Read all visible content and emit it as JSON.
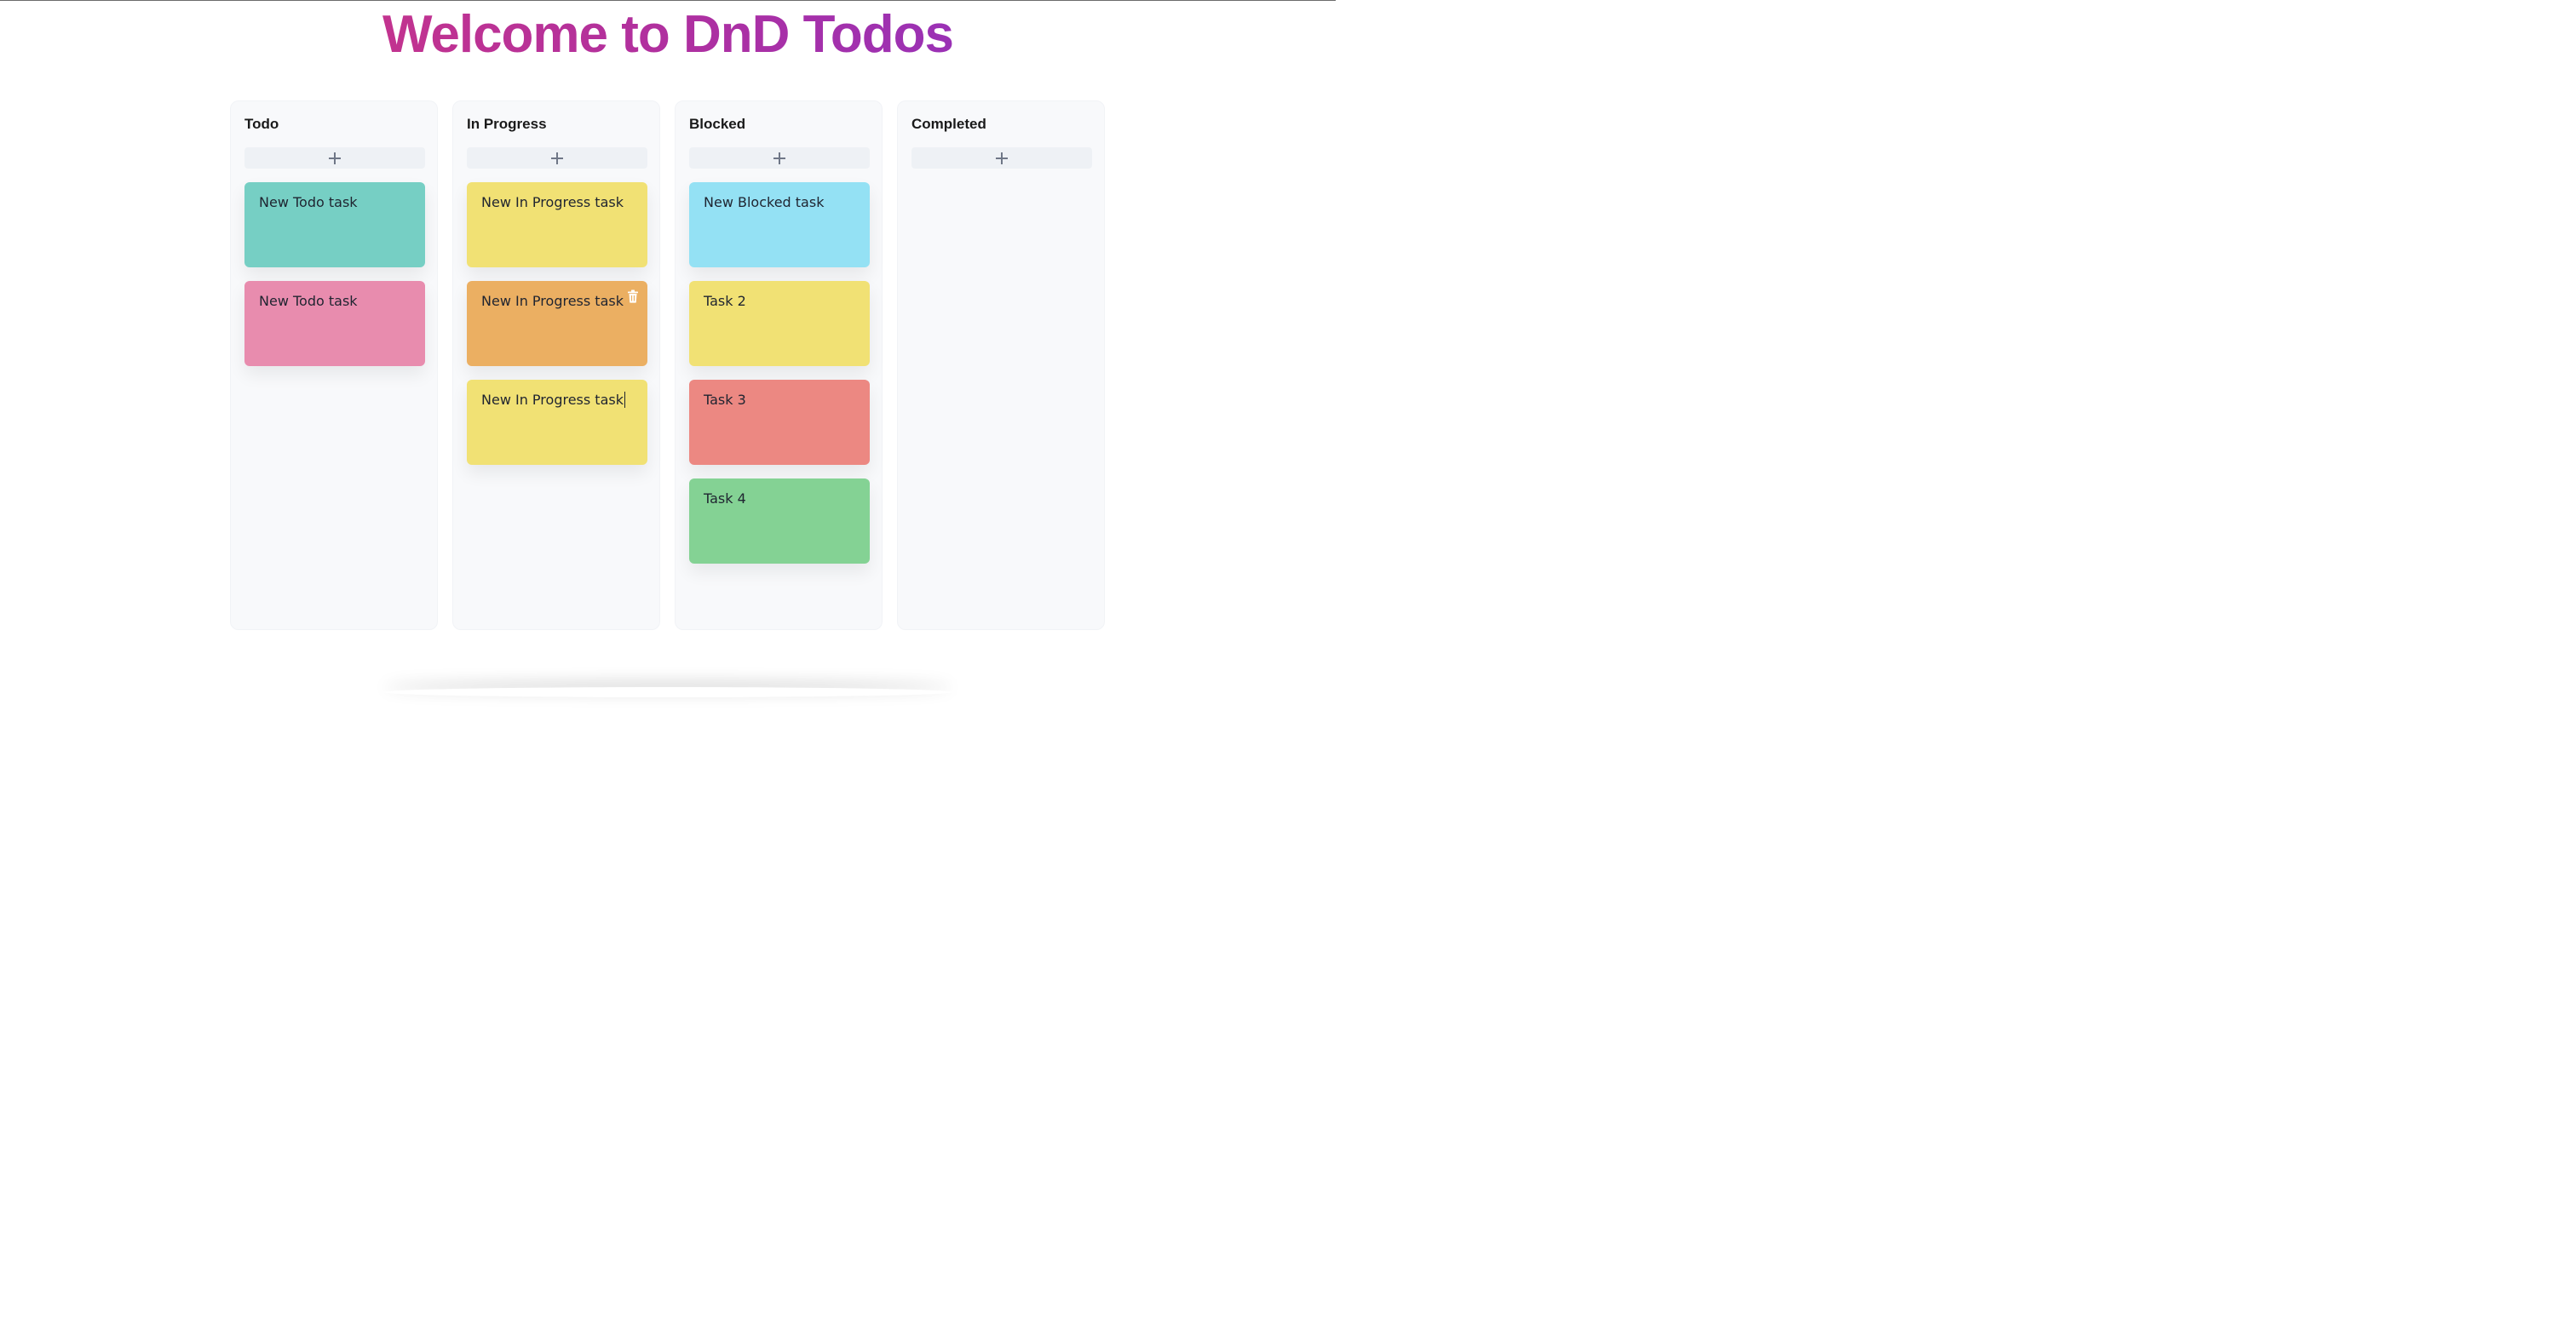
{
  "header": {
    "title": "Welcome to DnD Todos"
  },
  "colors": {
    "title_gradient_start": "#c2338f",
    "title_gradient_end": "#9a31b5",
    "column_bg": "#f8f9fb",
    "add_button_bg": "#eef1f5"
  },
  "columns": [
    {
      "title": "Todo",
      "add_icon": "plus-icon",
      "cards": [
        {
          "text": "New Todo task",
          "color": "#76cfc4"
        },
        {
          "text": "New Todo task",
          "color": "#e88cae"
        }
      ]
    },
    {
      "title": "In Progress",
      "add_icon": "plus-icon",
      "cards": [
        {
          "text": "New In Progress task",
          "color": "#f1e174"
        },
        {
          "text": "New In Progress task",
          "color": "#ebaf62",
          "icon": "trash-icon"
        },
        {
          "text": "New In Progress task",
          "color": "#f1e174",
          "editing": true
        }
      ]
    },
    {
      "title": "Blocked",
      "add_icon": "plus-icon",
      "cards": [
        {
          "text": "New Blocked task",
          "color": "#94e1f4"
        },
        {
          "text": "Task 2",
          "color": "#f1e174"
        },
        {
          "text": "Task 3",
          "color": "#ec8882"
        },
        {
          "text": "Task 4",
          "color": "#84d294"
        }
      ]
    },
    {
      "title": "Completed",
      "add_icon": "plus-icon",
      "cards": []
    }
  ]
}
